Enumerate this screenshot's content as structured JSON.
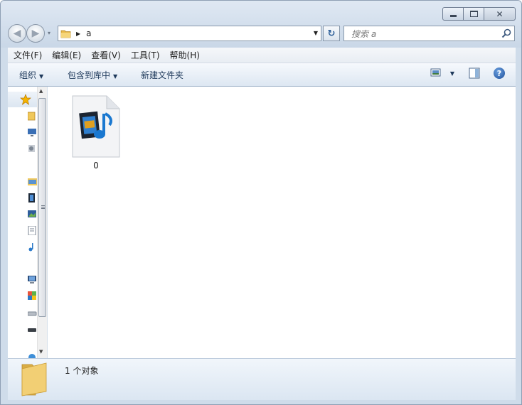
{
  "window": {
    "minimize_icon": "minimize-icon",
    "maximize_icon": "maximize-icon",
    "close_icon": "close-icon",
    "close_glyph": "✕"
  },
  "navigation": {
    "back_glyph": "◀",
    "forward_glyph": "▶",
    "history_dropdown_glyph": "▾"
  },
  "address_bar": {
    "folder_icon": "folder-icon",
    "separator_glyph": "▶",
    "path": "a",
    "dropdown_glyph": "▼",
    "refresh_glyph": "↻"
  },
  "search": {
    "placeholder": "搜索 a",
    "icon": "search-icon"
  },
  "menu": {
    "items": [
      {
        "label": "文件(F)"
      },
      {
        "label": "编辑(E)"
      },
      {
        "label": "查看(V)"
      },
      {
        "label": "工具(T)"
      },
      {
        "label": "帮助(H)"
      }
    ]
  },
  "toolbar": {
    "organize_label": "组织",
    "include_library_label": "包含到库中",
    "new_folder_label": "新建文件夹",
    "dropdown_glyph": "▼",
    "view_icon": "view-options-icon",
    "preview_pane_icon": "preview-pane-icon",
    "help_icon": "help-icon",
    "help_glyph": "?"
  },
  "nav_pane": {
    "items": [
      {
        "icon": "favorites-star-icon"
      },
      {
        "icon": "folder-icon"
      },
      {
        "icon": "desktop-icon"
      },
      {
        "icon": "recent-places-icon"
      },
      {
        "icon": "libraries-icon"
      },
      {
        "icon": "videos-icon"
      },
      {
        "icon": "pictures-icon"
      },
      {
        "icon": "documents-icon"
      },
      {
        "icon": "music-icon"
      },
      {
        "icon": "computer-icon"
      },
      {
        "icon": "local-disk-icon"
      },
      {
        "icon": "drive-icon"
      },
      {
        "icon": "drive-icon"
      },
      {
        "icon": "network-icon"
      }
    ],
    "scroll_up_glyph": "▲",
    "scroll_down_glyph": "▼"
  },
  "files": [
    {
      "name": "0",
      "icon": "media-file-icon"
    }
  ],
  "status_bar": {
    "text": "1 个对象",
    "icon": "folder-icon"
  },
  "colors": {
    "frame": "#cfdcea",
    "command_bar": "#dde7f2",
    "link_text": "#1e395b",
    "folder": "#f0c85a"
  }
}
